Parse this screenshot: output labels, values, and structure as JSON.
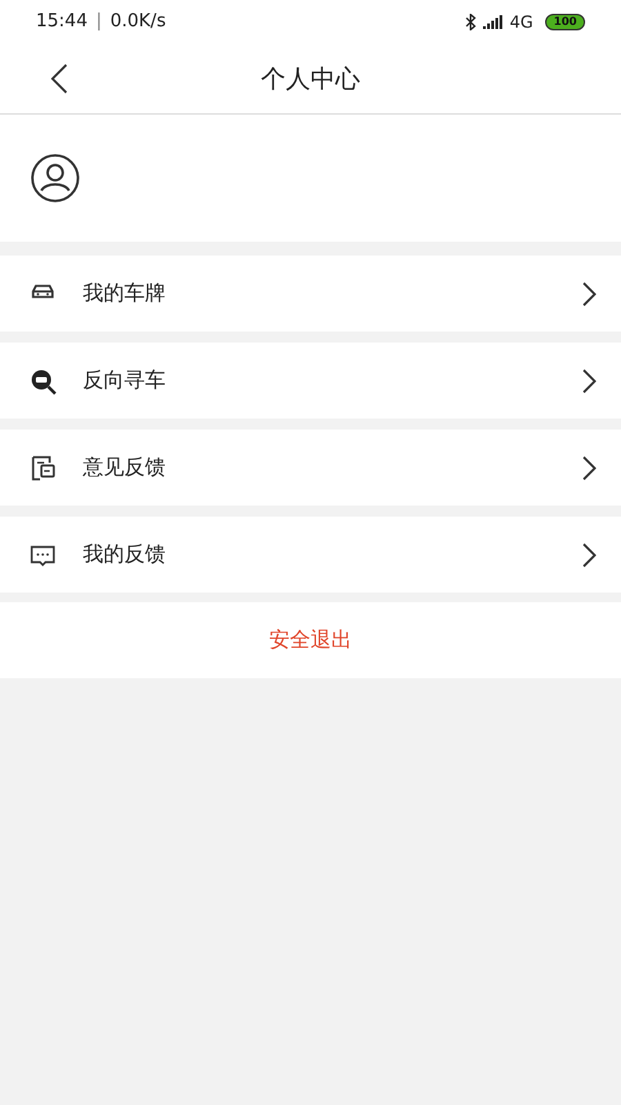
{
  "status_bar": {
    "time": "15:44",
    "separator": "|",
    "speed": "0.0K/s",
    "network": "4G",
    "battery": "100"
  },
  "header": {
    "title": "个人中心"
  },
  "menu": [
    {
      "kind": "plate",
      "label": "我的车牌"
    },
    {
      "kind": "find",
      "label": "反向寻车"
    },
    {
      "kind": "suggest",
      "label": "意见反馈"
    },
    {
      "kind": "feedback",
      "label": "我的反馈"
    }
  ],
  "logout": {
    "label": "安全退出"
  }
}
